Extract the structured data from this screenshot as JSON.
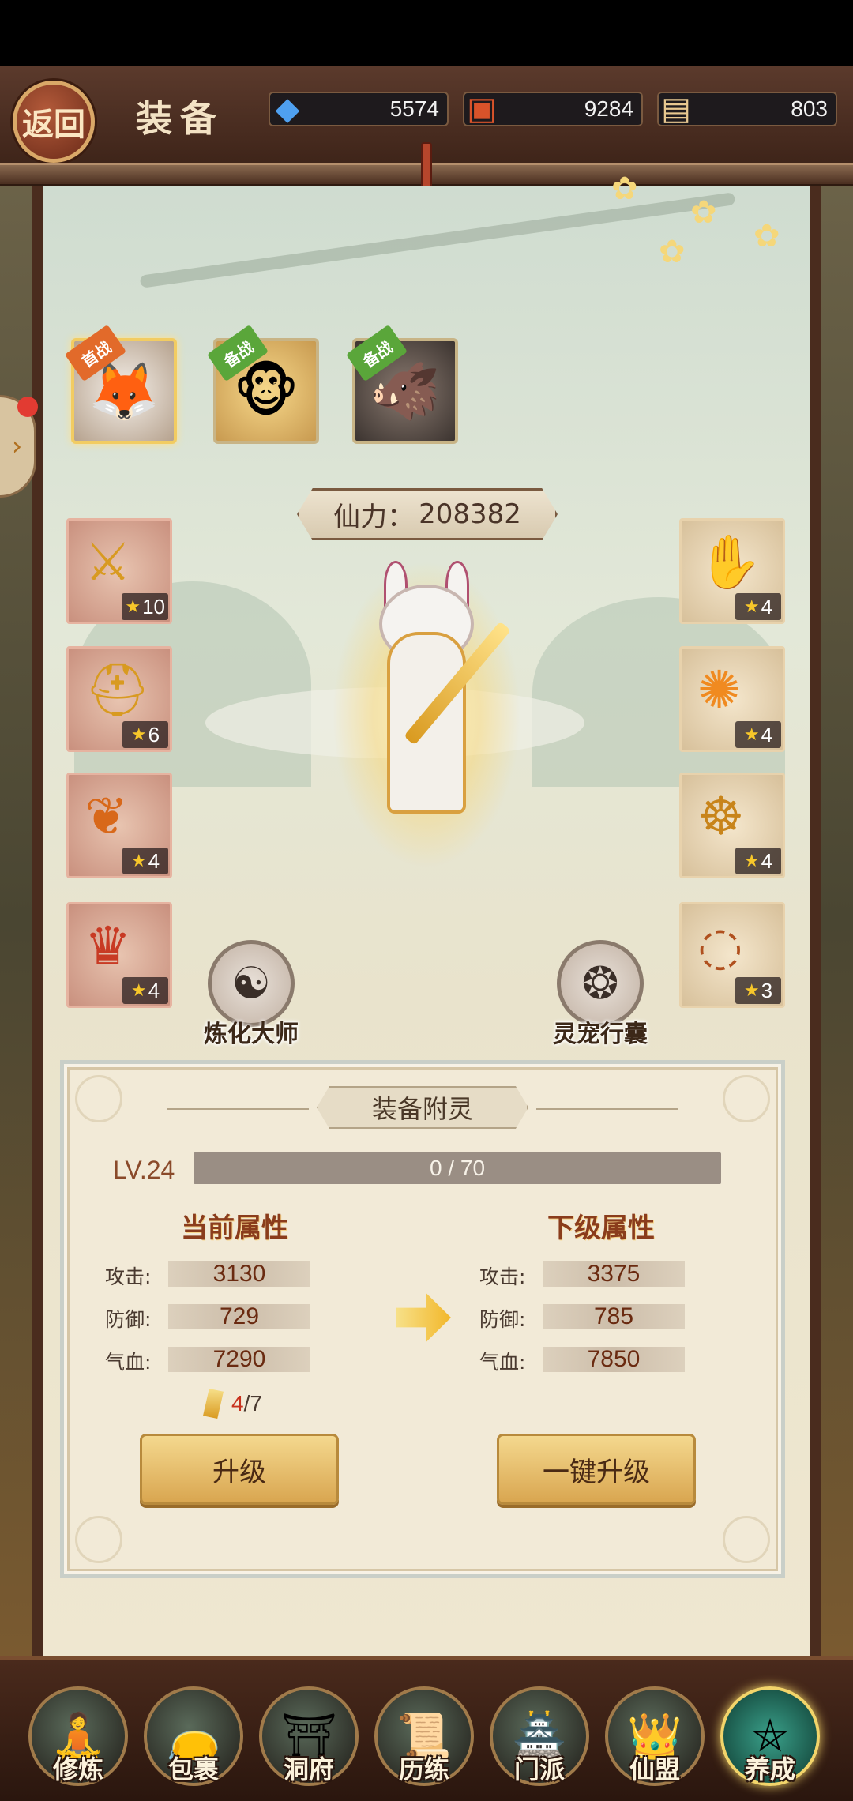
{
  "header": {
    "back_label": "返回",
    "title": "装备",
    "resources": [
      {
        "icon": "crystal-icon",
        "value": "5574"
      },
      {
        "icon": "treasure-icon",
        "value": "9284"
      },
      {
        "icon": "scroll-icon",
        "value": "803"
      }
    ]
  },
  "avatars": [
    {
      "tag": "首战",
      "icon": "fox-hero-avatar"
    },
    {
      "tag": "备战",
      "icon": "monkey-hero-avatar"
    },
    {
      "tag": "备战",
      "icon": "beast-hero-avatar"
    }
  ],
  "power": {
    "label": "仙力：",
    "value": "208382"
  },
  "equipment_left": [
    {
      "icon": "claw-weapon-icon",
      "stars": "10"
    },
    {
      "icon": "helmet-icon",
      "stars": "6"
    },
    {
      "icon": "bracer-icon",
      "stars": "4"
    },
    {
      "icon": "armor-icon",
      "stars": "4"
    }
  ],
  "equipment_right": [
    {
      "icon": "golden-claw-icon",
      "stars": "4"
    },
    {
      "icon": "flame-wing-icon",
      "stars": "4"
    },
    {
      "icon": "golden-mask-icon",
      "stars": "4"
    },
    {
      "icon": "necklace-icon",
      "stars": "3"
    }
  ],
  "skills": {
    "refine": "炼化大师",
    "pet_bag": "灵宠行囊"
  },
  "enchant": {
    "title": "装备附灵",
    "level": "LV.24",
    "progress_text": "0 / 70",
    "progress_fraction": 0,
    "current_title": "当前属性",
    "next_title": "下级属性",
    "current": [
      {
        "name": "攻击:",
        "value": "3130"
      },
      {
        "name": "防御:",
        "value": "729"
      },
      {
        "name": "气血:",
        "value": "7290"
      }
    ],
    "next": [
      {
        "name": "攻击:",
        "value": "3375"
      },
      {
        "name": "防御:",
        "value": "785"
      },
      {
        "name": "气血:",
        "value": "7850"
      }
    ],
    "material_have": "4",
    "material_need": "/7",
    "upgrade_label": "升级",
    "oneclick_label": "一键升级"
  },
  "bottom_nav": [
    {
      "label": "修炼",
      "icon": "cultivator-icon"
    },
    {
      "label": "包裹",
      "icon": "bag-icon"
    },
    {
      "label": "洞府",
      "icon": "cave-house-icon"
    },
    {
      "label": "历练",
      "icon": "scroll-map-icon"
    },
    {
      "label": "门派",
      "icon": "sect-gate-icon"
    },
    {
      "label": "仙盟",
      "icon": "alliance-icon"
    },
    {
      "label": "养成",
      "icon": "pentagram-icon",
      "active": true
    }
  ],
  "colors": {
    "frame_brown": "#4a2c1e",
    "accent_gold": "#d9a650",
    "stat_red": "#6a2a10"
  }
}
